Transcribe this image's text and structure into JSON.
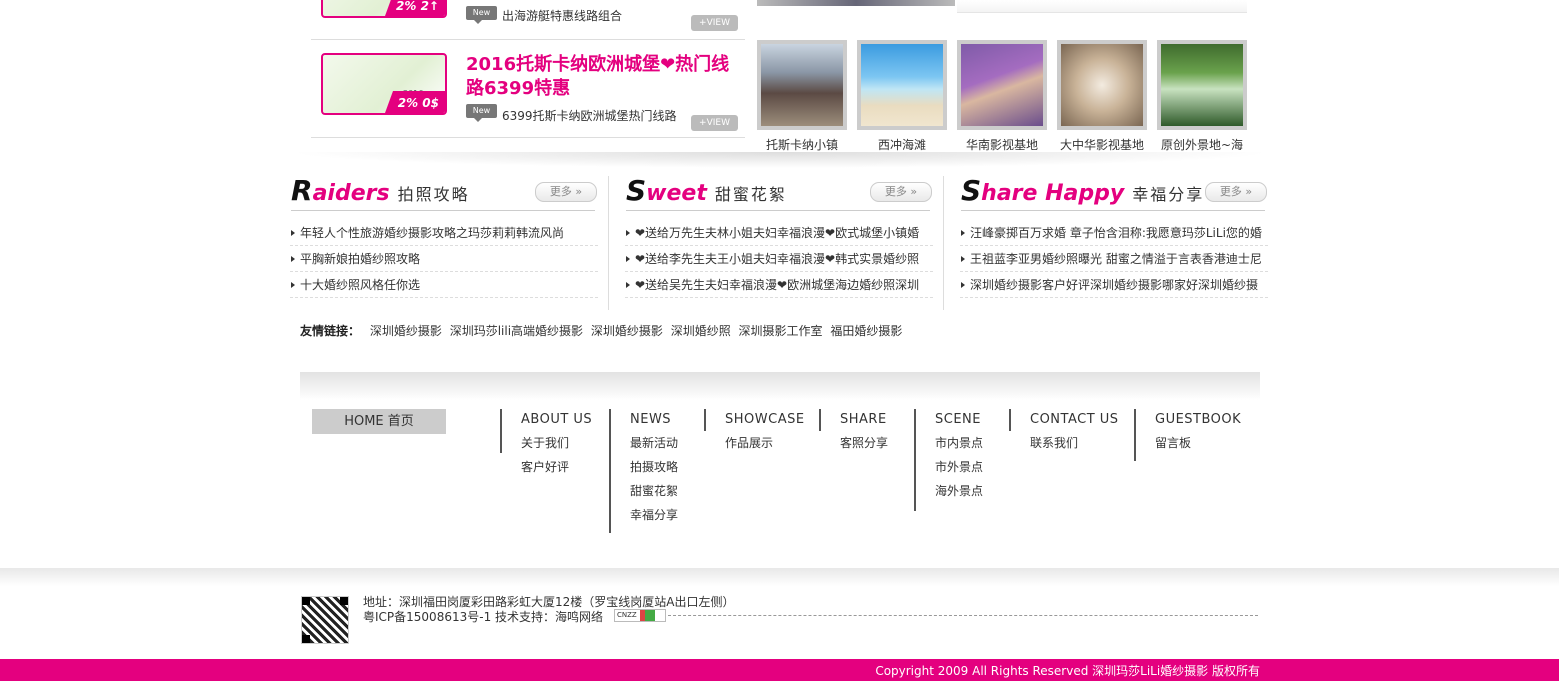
{
  "promos": [
    {
      "badge_text": "New",
      "subtitle": "出海游艇特惠线路组合",
      "view_label": "+VIEW",
      "thumb_text": "2% 2↑"
    },
    {
      "title": "2016托斯卡纳欧洲城堡❤热门线路6399特惠",
      "badge_text": "New",
      "subtitle": "6399托斯卡纳欧洲城堡热门线路",
      "view_label": "+VIEW",
      "thumb_text": "2% 0$",
      "thumb_year": "2016"
    }
  ],
  "gallery": [
    {
      "label": "托斯卡纳小镇",
      "icon": "photo-tuscany"
    },
    {
      "label": "西冲海滩",
      "icon": "photo-beach"
    },
    {
      "label": "华南影视基地",
      "icon": "photo-lavender"
    },
    {
      "label": "大中华影视基地",
      "icon": "photo-corridor"
    },
    {
      "label": "原创外景地~海",
      "icon": "photo-forest"
    }
  ],
  "columns": [
    {
      "en_first": "R",
      "en_rest": "aiders",
      "cn": "拍照攻略",
      "more": "更多 »",
      "items": [
        "年轻人个性旅游婚纱摄影攻略之玛莎莉莉韩流风尚",
        "平胸新娘拍婚纱照攻略",
        "十大婚纱照风格任你选"
      ]
    },
    {
      "en_first": "S",
      "en_rest": "weet",
      "cn": "甜蜜花絮",
      "more": "更多 »",
      "items": [
        "❤送给万先生夫林小姐夫妇幸福浪漫❤欧式城堡小镇婚",
        "❤送给李先生夫王小姐夫妇幸福浪漫❤韩式实景婚纱照",
        "❤送给吴先生夫妇幸福浪漫❤欧洲城堡海边婚纱照深圳"
      ]
    },
    {
      "en_first": "S",
      "en_rest": "hare Happy",
      "cn": "幸福分享",
      "more": "更多 »",
      "items": [
        "汪峰豪掷百万求婚 章子怡含泪称:我愿意玛莎LiLi您的婚",
        "王祖蓝李亚男婚纱照曝光 甜蜜之情溢于言表香港迪士尼",
        "深圳婚纱摄影客户好评深圳婚纱摄影哪家好深圳婚纱摄"
      ]
    }
  ],
  "friend_links": {
    "label": "友情链接：",
    "links": [
      "深圳婚纱摄影",
      "深圳玛莎lili高端婚纱摄影",
      "深圳婚纱摄影",
      "深圳婚纱照",
      "深圳摄影工作室",
      "福田婚纱摄影"
    ]
  },
  "footer_nav": {
    "home": "HOME 首页",
    "groups": [
      {
        "title": "ABOUT US",
        "items": [
          "关于我们",
          "客户好评"
        ]
      },
      {
        "title": "NEWS",
        "items": [
          "最新活动",
          "拍摄攻略",
          "甜蜜花絮",
          "幸福分享"
        ]
      },
      {
        "title": "SHOWCASE",
        "items": [
          "作品展示"
        ]
      },
      {
        "title": "SHARE",
        "items": [
          "客照分享"
        ]
      },
      {
        "title": "SCENE",
        "items": [
          "市内景点",
          "市外景点",
          "海外景点"
        ]
      },
      {
        "title": "CONTACT US",
        "items": [
          "联系我们"
        ]
      },
      {
        "title": "GUESTBOOK",
        "items": [
          "留言板"
        ]
      }
    ]
  },
  "footer": {
    "address": "地址：深圳福田岗厦彩田路彩虹大厦12楼（罗宝线岗厦站A出口左侧）",
    "icp": "粤ICP备15008613号-1 技术支持：海鸣网络",
    "cnzz": "CNZZ",
    "copyright": "Copyright 2009 All Rights Reserved 深圳玛莎LiLi婚纱摄影 版权所有"
  },
  "colors": {
    "accent": "#e4007f"
  }
}
